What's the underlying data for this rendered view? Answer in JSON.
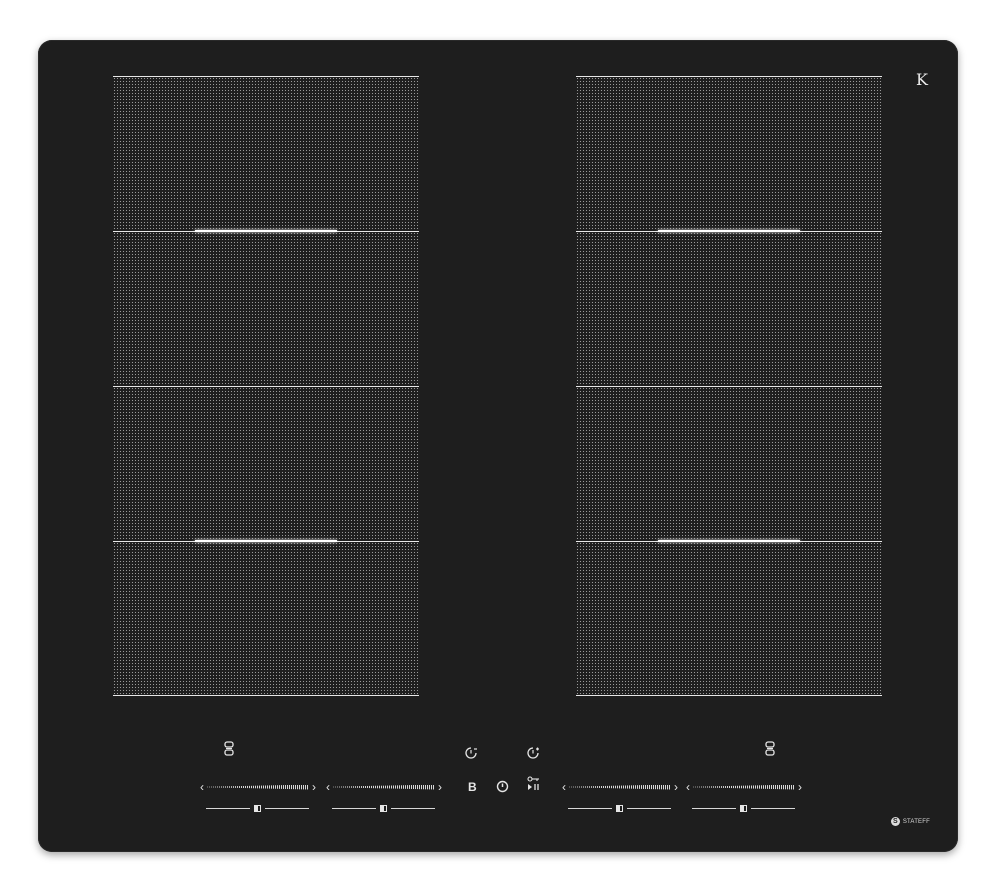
{
  "brand": {
    "mark": "K"
  },
  "logo": {
    "letter": "S",
    "name": "STATEFF"
  },
  "controls": {
    "boost_label": "B",
    "colors": {
      "glass": "#1e1e1e",
      "print": "#e6e6e6"
    },
    "icons": [
      "bridge-icon",
      "timer-minus-icon",
      "timer-plus-icon",
      "boost",
      "power-icon",
      "pause-lock-icon",
      "bridge-icon"
    ]
  }
}
